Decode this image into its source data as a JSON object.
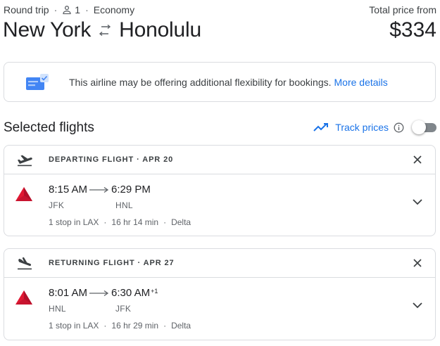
{
  "header": {
    "trip_type": "Round trip",
    "passengers": "1",
    "cabin": "Economy",
    "origin": "New York",
    "destination": "Honolulu",
    "total_label": "Total price from",
    "total_price": "$334"
  },
  "notice": {
    "message": "This airline may be offering additional flexibility for bookings.",
    "link": "More details"
  },
  "selected": {
    "title": "Selected flights",
    "track_prices": "Track prices",
    "track_enabled": false
  },
  "flights": [
    {
      "heading": "DEPARTING FLIGHT",
      "date": "APR 20",
      "depart_time": "8:15 AM",
      "arrive_time": "6:29 PM",
      "arrive_day_offset": "",
      "from_code": "JFK",
      "to_code": "HNL",
      "stops": "1 stop in LAX",
      "duration": "16 hr 14 min",
      "airline": "Delta"
    },
    {
      "heading": "RETURNING FLIGHT",
      "date": "APR 27",
      "depart_time": "8:01 AM",
      "arrive_time": "6:30 AM",
      "arrive_day_offset": "+1",
      "from_code": "HNL",
      "to_code": "JFK",
      "stops": "1 stop in LAX",
      "duration": "16 hr 29 min",
      "airline": "Delta"
    }
  ],
  "colors": {
    "accent": "#1a73e8",
    "airline_red": "#e01933",
    "border": "#dadce0"
  },
  "icons": {
    "person": "person-icon",
    "swap": "swap-arrows-icon",
    "notice": "ticket-flex-icon",
    "trend": "trending-line-icon",
    "info": "info-icon",
    "takeoff": "plane-takeoff-icon",
    "landing": "plane-landing-icon",
    "close": "close-icon",
    "expand": "chevron-down-icon",
    "airline": "delta-logo"
  }
}
